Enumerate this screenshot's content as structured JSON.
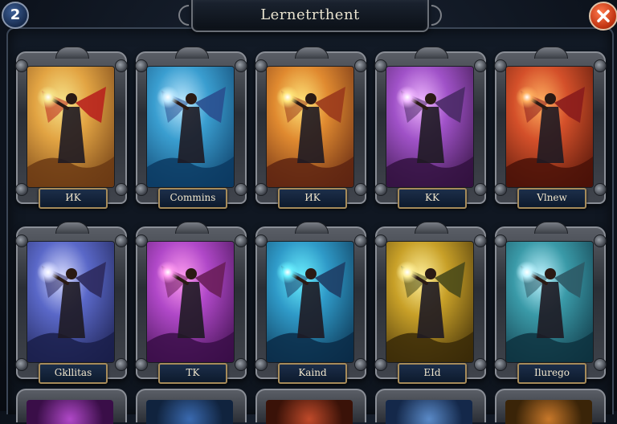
{
  "header": {
    "title": "Lernetrthent",
    "count": "2",
    "close_label": "×"
  },
  "cards": [
    {
      "label": "ИK",
      "palette": {
        "a": "#e2a443",
        "b": "#6b3a14",
        "c": "#f7e48a",
        "wing": "#b8231e"
      }
    },
    {
      "label": "Commins",
      "palette": {
        "a": "#3a9ed0",
        "b": "#0c3a62",
        "c": "#bfe9ff",
        "wing": "#2a4f8f"
      }
    },
    {
      "label": "ИK",
      "palette": {
        "a": "#e08a30",
        "b": "#5e2412",
        "c": "#ffe57a",
        "wing": "#9a3a1c"
      }
    },
    {
      "label": "KK",
      "palette": {
        "a": "#a052c8",
        "b": "#33123f",
        "c": "#f0b8ff",
        "wing": "#4a2a66"
      }
    },
    {
      "label": "Vlnew",
      "palette": {
        "a": "#d4502a",
        "b": "#4a1208",
        "c": "#ffb060",
        "wing": "#8a1c1c"
      }
    },
    {
      "label": "Gkllitas",
      "palette": {
        "a": "#5a68c8",
        "b": "#1a1e4a",
        "c": "#d8dcff",
        "wing": "#2e2a5e"
      }
    },
    {
      "label": "TK",
      "palette": {
        "a": "#b048c8",
        "b": "#3a0e48",
        "c": "#ff9cf0",
        "wing": "#6a1e5a"
      }
    },
    {
      "label": "Kaind",
      "palette": {
        "a": "#2f9ac8",
        "b": "#0a2c48",
        "c": "#6af0ff",
        "wing": "#1e3e66"
      }
    },
    {
      "label": "EId",
      "palette": {
        "a": "#c8a028",
        "b": "#3a2a08",
        "c": "#fff09a",
        "wing": "#4a4a1a"
      }
    },
    {
      "label": "Ilurego",
      "palette": {
        "a": "#3a9aa8",
        "b": "#0e3240",
        "c": "#bff4ff",
        "wing": "#2e5a66"
      }
    }
  ],
  "bottom_row": [
    {
      "palette": {
        "a": "#b048c8",
        "b": "#3a0e48"
      }
    },
    {
      "palette": {
        "a": "#3a6ab0",
        "b": "#10233e"
      }
    },
    {
      "palette": {
        "a": "#c04a2a",
        "b": "#3a1208"
      }
    },
    {
      "palette": {
        "a": "#5a8ac8",
        "b": "#14284a"
      }
    },
    {
      "palette": {
        "a": "#c8782a",
        "b": "#3a2408"
      }
    }
  ]
}
